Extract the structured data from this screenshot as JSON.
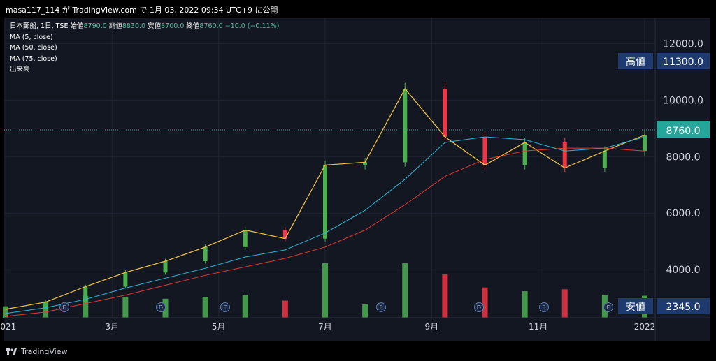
{
  "header": {
    "publisher_line": "masa117_114 が TradingView.com で 1月 03, 2022 09:34 UTC+9 に公開"
  },
  "legend": {
    "symbol": "日本郵船, 1日, TSE",
    "open_label": "始値",
    "open": "8790.0",
    "high_label": "高値",
    "high": "8830.0",
    "low_label": "安値",
    "low": "8700.0",
    "close_label": "終値",
    "close": "8760.0",
    "change": "−10.0 (−0.11%)",
    "indicators": [
      "MA (5, close)",
      "MA (50, close)",
      "MA (75, close)",
      "出来高"
    ]
  },
  "price_axis": {
    "ticks": [
      "12000.0",
      "10000.0",
      "8000.0",
      "6000.0",
      "4000.0"
    ],
    "high_badge": {
      "label": "高値",
      "value": "11300.0"
    },
    "low_badge": {
      "label": "安値",
      "value": "2345.0"
    },
    "last_price": "8760.0"
  },
  "time_axis": {
    "labels": [
      "2021",
      "3月",
      "5月",
      "7月",
      "9月",
      "11月",
      "2022"
    ]
  },
  "event_markers": [
    "E",
    "D",
    "E",
    "E",
    "D",
    "E",
    "E"
  ],
  "footer": {
    "brand": "TradingView"
  },
  "colors": {
    "up": "#4caf50",
    "down": "#f23645",
    "ma5": "#f5c542",
    "ma50": "#2ab7d6",
    "ma75": "#e53935",
    "badge": "#1e3a6e",
    "last": "#26a69a"
  },
  "chart_data": {
    "type": "line",
    "title": "",
    "xlabel": "",
    "ylabel": "",
    "ylim": [
      2300,
      12800
    ],
    "x": [
      "2021-01",
      "2021-02",
      "2021-03",
      "2021-04",
      "2021-05",
      "2021-06",
      "2021-07",
      "2021-08-early",
      "2021-08-late",
      "2021-09-early",
      "2021-09-late",
      "2021-10-early",
      "2021-10-late",
      "2021-11",
      "2021-11-late",
      "2021-12",
      "2021-12-late"
    ],
    "series": [
      {
        "values": [
          2600,
          2850,
          3400,
          3900,
          4300,
          4800,
          5400,
          5100,
          7700,
          7800,
          10400,
          8700,
          7700,
          8500,
          7600,
          8200,
          8760
        ]
      },
      {
        "values": [
          2450,
          2650,
          2950,
          3350,
          3700,
          4050,
          4450,
          4700,
          5300,
          6100,
          7200,
          8500,
          8700,
          8600,
          8200,
          8300,
          8700
        ]
      },
      {
        "values": [
          2350,
          2500,
          2800,
          3100,
          3450,
          3800,
          4100,
          4400,
          4800,
          5400,
          6300,
          7300,
          7900,
          8200,
          8300,
          8300,
          8200
        ]
      }
    ]
  }
}
